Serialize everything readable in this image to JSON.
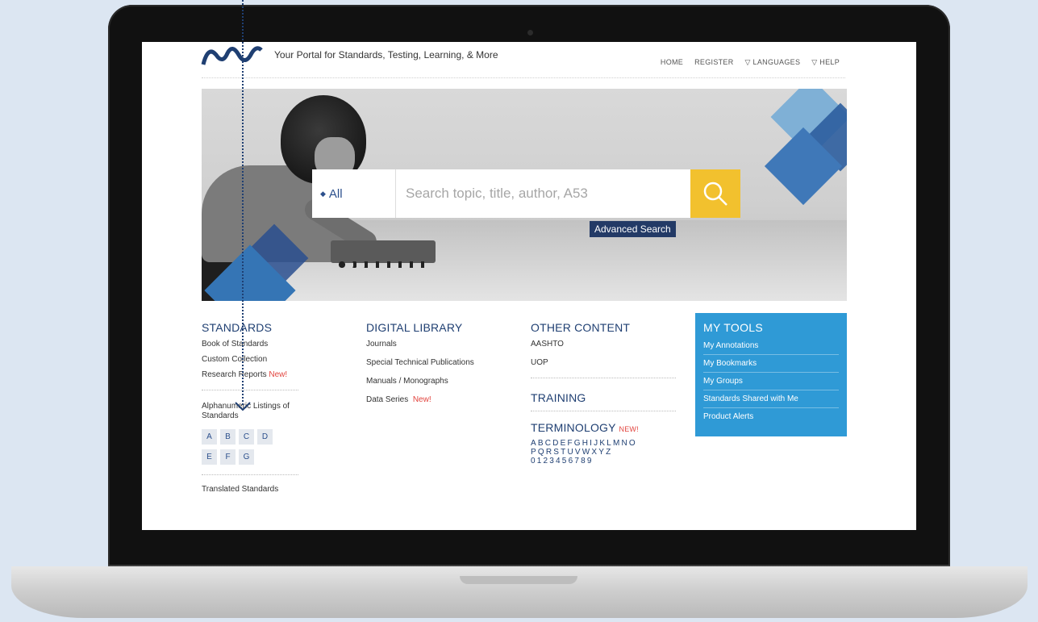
{
  "header": {
    "tagline": "Your Portal for Standards, Testing, Learning, & More",
    "nav": [
      "HOME",
      "REGISTER",
      "▽ LANGUAGES",
      "▽ HELP"
    ]
  },
  "search": {
    "scope": "All",
    "placeholder": "Search topic, title, author, A53",
    "advanced": "Advanced Search"
  },
  "standards": {
    "title": "STANDARDS",
    "links": [
      "Book of Standards",
      "Custom Collection",
      "Research Reports"
    ],
    "new_label": "New!",
    "alpha_title": "Alphanumeric Listings of Standards",
    "letters_row1": [
      "A",
      "B",
      "C",
      "D"
    ],
    "letters_row2": [
      "E",
      "F",
      "G"
    ],
    "translated": "Translated Standards"
  },
  "digital_library": {
    "title": "DIGITAL LIBRARY",
    "links": [
      "Journals",
      "Special Technical Publications",
      "Manuals / Monographs",
      "Data Series"
    ],
    "new_label": "New!"
  },
  "other_content": {
    "title": "OTHER CONTENT",
    "links": [
      "AASHTO",
      "UOP"
    ],
    "training": "TRAINING",
    "terminology": "TERMINOLOGY",
    "terminology_new": "NEW!",
    "terms_line1": "ABCDEFGHIJKLMNO",
    "terms_line2": "PQRSTUVWXYZ",
    "terms_line3": "0123456789"
  },
  "my_tools": {
    "title": "MY TOOLS",
    "items": [
      "My Annotations",
      "My Bookmarks",
      "My Groups",
      "Standards Shared with Me",
      "Product Alerts"
    ]
  },
  "colors": {
    "brand": "#1f3f72",
    "accent": "#2f9ad6",
    "search_button": "#f2c12e",
    "new": "#e2443e"
  }
}
